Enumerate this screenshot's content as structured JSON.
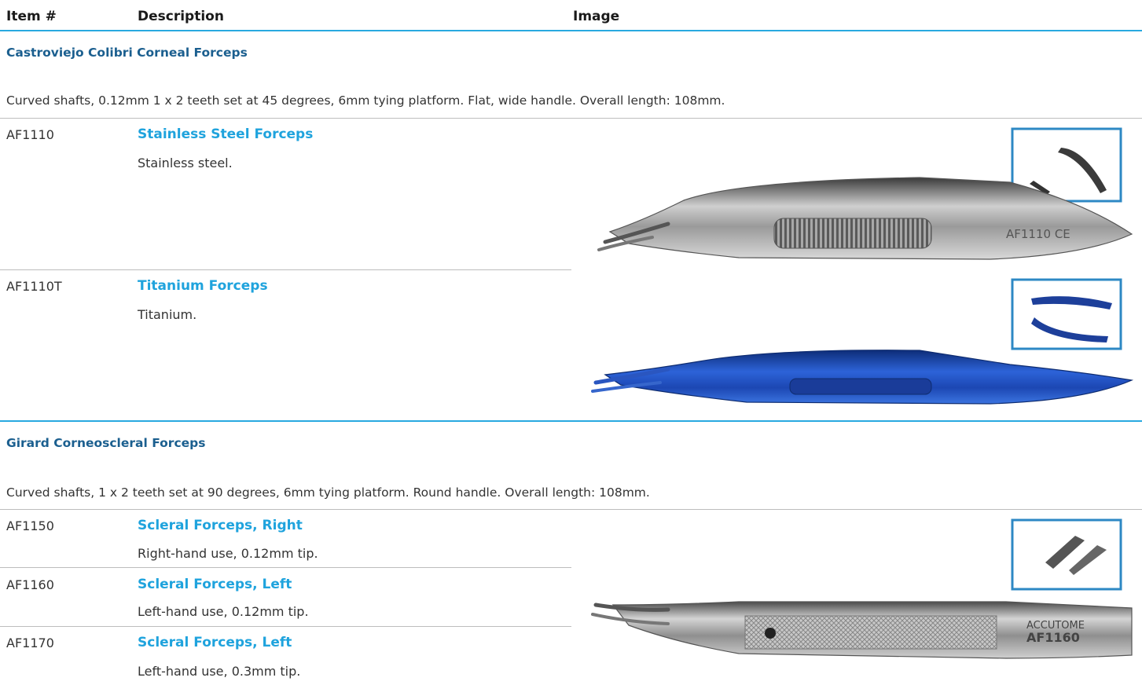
{
  "header": {
    "item_col": "Item #",
    "description_col": "Description",
    "image_col": "Image"
  },
  "accent_color": "#29a9e0",
  "title_color": "#1b5f8f",
  "link_color": "#1fa3dd",
  "sections": [
    {
      "title": "Castroviejo Colibri Corneal Forceps",
      "description": "Curved shafts, 0.12mm 1 x 2 teeth set at 45 degrees, 6mm tying platform. Flat, wide handle. Overall length: 108mm.",
      "items": [
        {
          "item_no": "AF1110",
          "name": "Stainless Steel Forceps",
          "detail": "Stainless steel."
        },
        {
          "item_no": "AF1110T",
          "name": "Titanium Forceps",
          "detail": "Titanium."
        }
      ],
      "images": [
        {
          "icon": "stainless-steel-forceps-image",
          "engraving": "AF1110 CE"
        },
        {
          "icon": "titanium-forceps-image"
        }
      ]
    },
    {
      "title": "Girard Corneoscleral Forceps",
      "description": "Curved shafts, 1 x 2 teeth set at 90 degrees, 6mm tying platform. Round handle. Overall length: 108mm.",
      "items": [
        {
          "item_no": "AF1150",
          "name": "Scleral Forceps, Right",
          "detail": "Right-hand use, 0.12mm tip."
        },
        {
          "item_no": "AF1160",
          "name": "Scleral Forceps, Left",
          "detail": "Left-hand use, 0.12mm tip."
        },
        {
          "item_no": "AF1170",
          "name": "Scleral Forceps, Left",
          "detail": "Left-hand use, 0.3mm tip."
        }
      ],
      "images": [
        {
          "icon": "scleral-forceps-image",
          "engraving": [
            "ACCUTOME",
            "AF1160"
          ]
        }
      ]
    }
  ]
}
